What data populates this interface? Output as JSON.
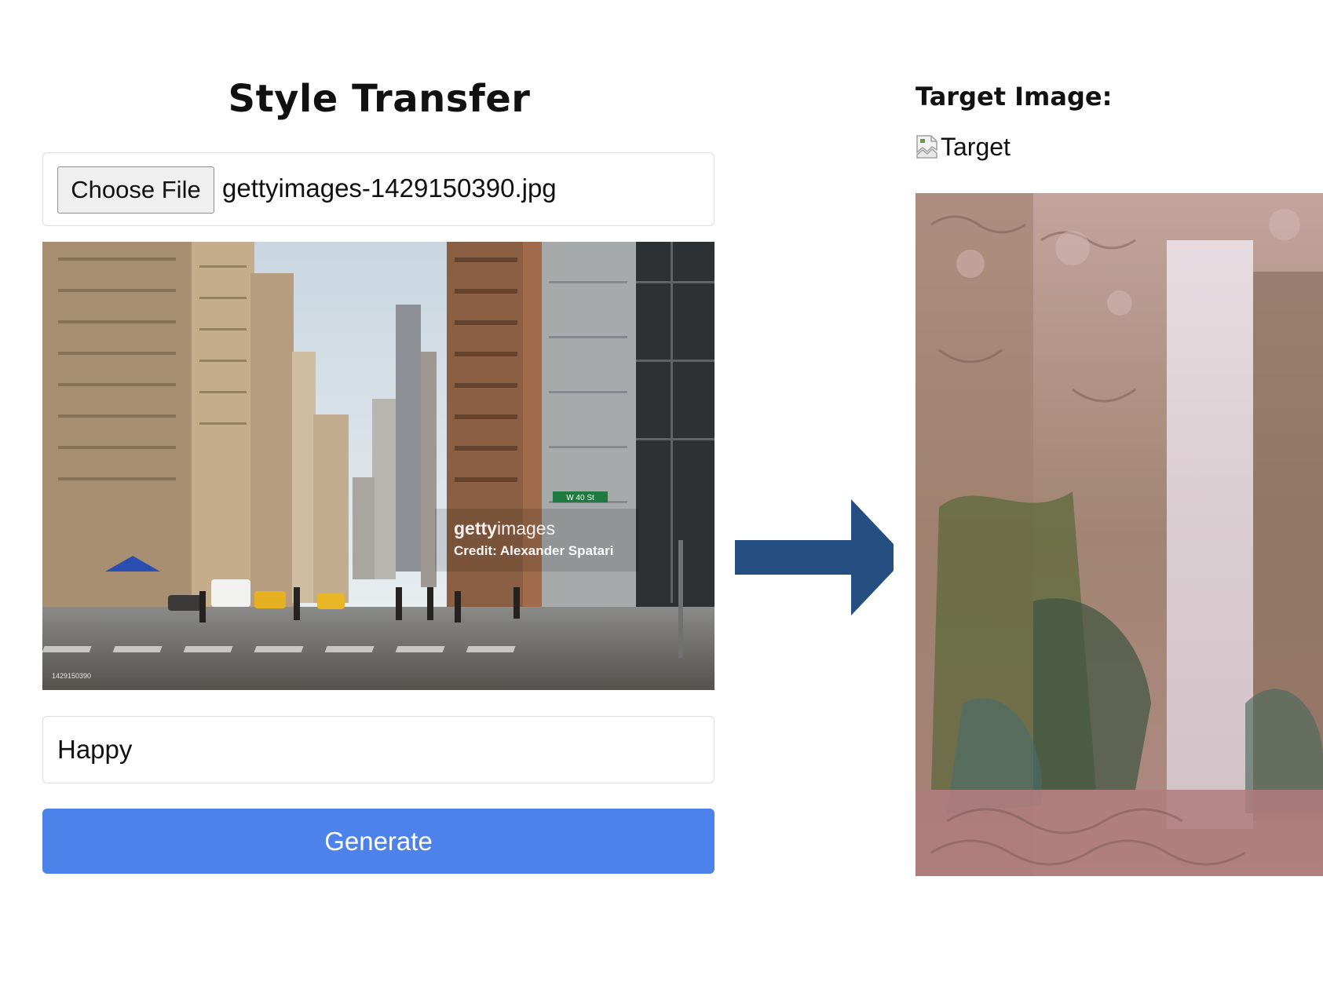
{
  "app": {
    "title": "Style Transfer"
  },
  "upload": {
    "button_label": "Choose File",
    "file_name": "gettyimages-1429150390.jpg"
  },
  "preview_image": {
    "watermark_brand_bold": "getty",
    "watermark_brand_light": "images",
    "watermark_credit": "Credit: Alexander Spatari",
    "watermark_id": "1429150390",
    "street_sign": "W 40 St"
  },
  "prompt": {
    "value": "Happy"
  },
  "actions": {
    "generate_label": "Generate"
  },
  "arrow": {
    "icon": "right-arrow-icon",
    "color": "#244f80"
  },
  "target": {
    "label": "Target Image:",
    "alt_text": "Target",
    "broken_icon": "broken-image-icon"
  },
  "colors": {
    "accent": "#4d82eb",
    "arrow": "#244f80"
  }
}
